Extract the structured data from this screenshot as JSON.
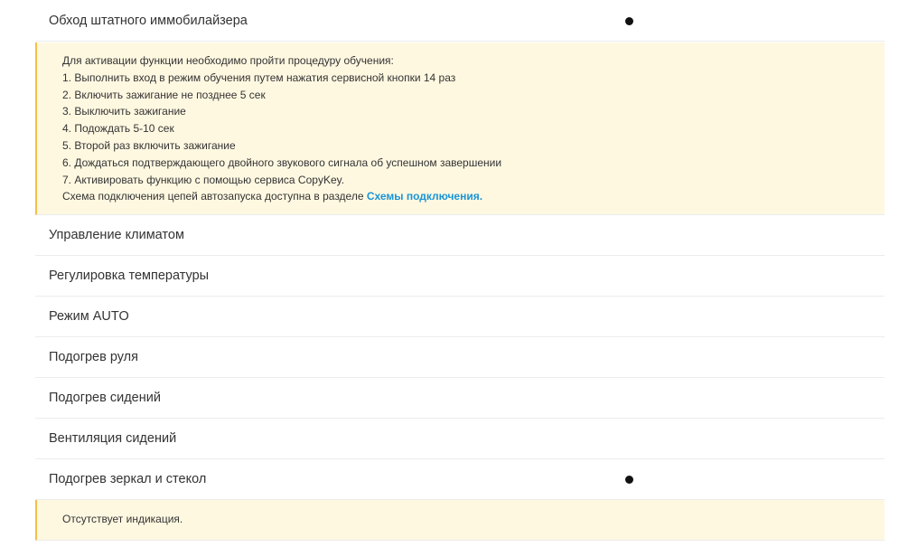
{
  "rows": [
    {
      "label": "Обход штатного иммобилайзера",
      "supported": true
    },
    {
      "label": "Управление климатом",
      "supported": false
    },
    {
      "label": "Регулировка температуры",
      "supported": false
    },
    {
      "label": "Режим AUTO",
      "supported": false
    },
    {
      "label": "Подогрев руля",
      "supported": false
    },
    {
      "label": "Подогрев сидений",
      "supported": false
    },
    {
      "label": "Вентиляция сидений",
      "supported": false
    },
    {
      "label": "Подогрев зеркал и стекол",
      "supported": true
    }
  ],
  "immobilizer_note": {
    "intro": "Для активации функции необходимо пройти процедуру обучения:",
    "steps": [
      "1. Выполнить вход в режим обучения путем нажатия сервисной кнопки 14 раз",
      "2. Включить зажигание не позднее 5 сек",
      "3. Выключить зажигание",
      "4. Подождать 5-10 сек",
      "5. Второй раз включить зажигание",
      "6. Дождаться подтверждающего двойного звукового сигнала об успешном завершении",
      "7. Активировать функцию с помощью сервиса CopyKey."
    ],
    "scheme_text": "Схема подключения цепей автозапуска доступна в разделе ",
    "scheme_link": "Схемы подключения."
  },
  "mirrors_note": {
    "text": "Отсутствует индикация."
  },
  "colors": {
    "note_background": "#fff8e1",
    "note_accent": "#f3c04b",
    "link": "#1a95d6",
    "divider": "#ececec"
  }
}
